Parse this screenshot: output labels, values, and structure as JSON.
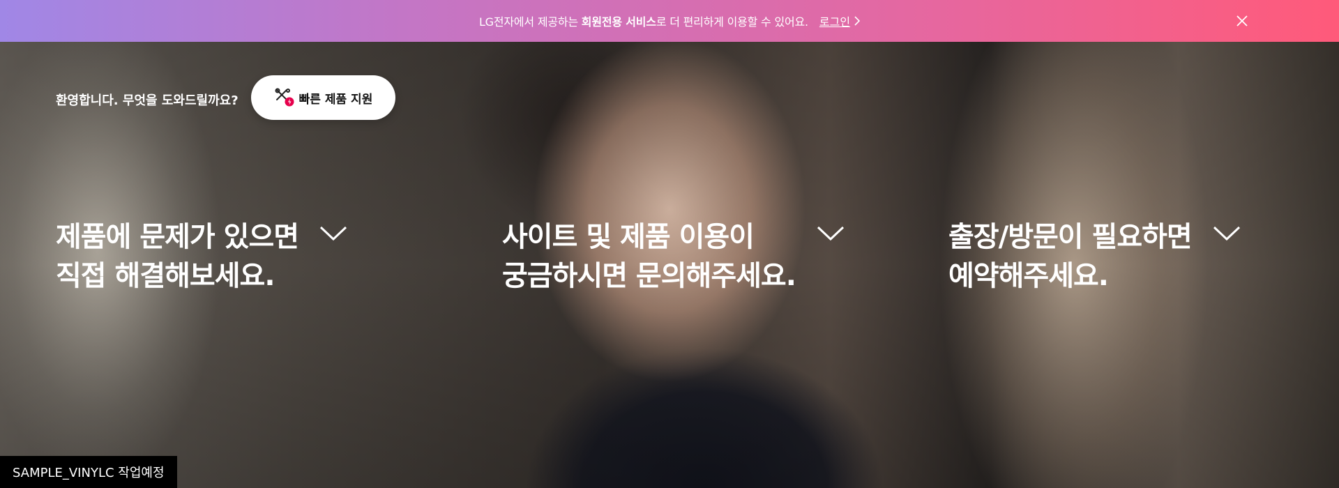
{
  "banner": {
    "text_prefix": "LG전자에서 제공하는 ",
    "text_bold": "회원전용 서비스",
    "text_suffix": "로 더 편리하게 이용할 수 있어요.",
    "login_label": "로그인",
    "close_icon": "close-icon",
    "gradient_colors": [
      "#a087e6",
      "#ff5a7a"
    ]
  },
  "welcome": {
    "greeting": "환영합니다. 무엇을 도와드릴까요?",
    "quick_support_label": "빠른 제품 지원",
    "quick_support_icon": "tools-icon",
    "badge_color": "#e6004c"
  },
  "services": [
    {
      "line1": "제품에 문제가 있으면",
      "line2": "직접 해결해보세요.",
      "icon": "chevron-down-icon"
    },
    {
      "line1": "사이트 및 제품 이용이",
      "line2": "궁금하시면 문의해주세요.",
      "icon": "chevron-down-icon"
    },
    {
      "line1": "출장/방문이 필요하면",
      "line2": "예약해주세요.",
      "icon": "chevron-down-icon"
    }
  ],
  "sample_label": "SAMPLE_VINYLC 작업예정"
}
